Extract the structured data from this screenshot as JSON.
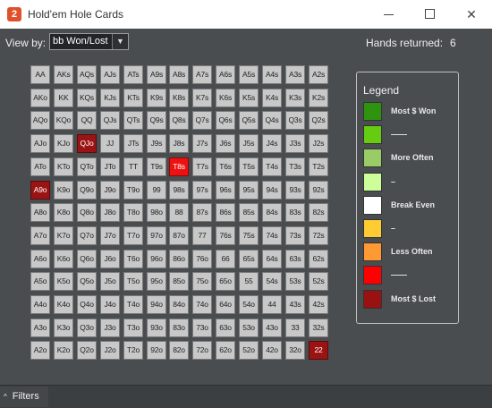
{
  "window": {
    "app_icon": "2",
    "title": "Hold'em Hole Cards",
    "minimize_icon": "minimize-icon",
    "maximize_icon": "maximize-icon",
    "close_icon": "close-icon",
    "close_glyph": "✕"
  },
  "toolbar": {
    "view_by_label": "View by:",
    "view_by_value": "bb Won/Lost",
    "dropdown_arrow": "▼",
    "hands_returned_label": "Hands returned:",
    "hands_returned_value": "6"
  },
  "grid": {
    "rows": [
      [
        "AA",
        "AKs",
        "AQs",
        "AJs",
        "ATs",
        "A9s",
        "A8s",
        "A7s",
        "A6s",
        "A5s",
        "A4s",
        "A3s",
        "A2s"
      ],
      [
        "AKo",
        "KK",
        "KQs",
        "KJs",
        "KTs",
        "K9s",
        "K8s",
        "K7s",
        "K6s",
        "K5s",
        "K4s",
        "K3s",
        "K2s"
      ],
      [
        "AQo",
        "KQo",
        "QQ",
        "QJs",
        "QTs",
        "Q9s",
        "Q8s",
        "Q7s",
        "Q6s",
        "Q5s",
        "Q4s",
        "Q3s",
        "Q2s"
      ],
      [
        "AJo",
        "KJo",
        "QJo",
        "JJ",
        "JTs",
        "J9s",
        "J8s",
        "J7s",
        "J6s",
        "J5s",
        "J4s",
        "J3s",
        "J2s"
      ],
      [
        "ATo",
        "KTo",
        "QTo",
        "JTo",
        "TT",
        "T9s",
        "T8s",
        "T7s",
        "T6s",
        "T5s",
        "T4s",
        "T3s",
        "T2s"
      ],
      [
        "A9o",
        "K9o",
        "Q9o",
        "J9o",
        "T9o",
        "99",
        "98s",
        "97s",
        "96s",
        "95s",
        "94s",
        "93s",
        "92s"
      ],
      [
        "A8o",
        "K8o",
        "Q8o",
        "J8o",
        "T8o",
        "98o",
        "88",
        "87s",
        "86s",
        "85s",
        "84s",
        "83s",
        "82s"
      ],
      [
        "A7o",
        "K7o",
        "Q7o",
        "J7o",
        "T7o",
        "97o",
        "87o",
        "77",
        "76s",
        "75s",
        "74s",
        "73s",
        "72s"
      ],
      [
        "A6o",
        "K6o",
        "Q6o",
        "J6o",
        "T6o",
        "96o",
        "86o",
        "76o",
        "66",
        "65s",
        "64s",
        "63s",
        "62s"
      ],
      [
        "A5o",
        "K5o",
        "Q5o",
        "J5o",
        "T5o",
        "95o",
        "85o",
        "75o",
        "65o",
        "55",
        "54s",
        "53s",
        "52s"
      ],
      [
        "A4o",
        "K4o",
        "Q4o",
        "J4o",
        "T4o",
        "94o",
        "84o",
        "74o",
        "64o",
        "54o",
        "44",
        "43s",
        "42s"
      ],
      [
        "A3o",
        "K3o",
        "Q3o",
        "J3o",
        "T3o",
        "93o",
        "83o",
        "73o",
        "63o",
        "53o",
        "43o",
        "33",
        "32s"
      ],
      [
        "A2o",
        "K2o",
        "Q2o",
        "J2o",
        "T2o",
        "92o",
        "82o",
        "72o",
        "62o",
        "52o",
        "42o",
        "32o",
        "22"
      ]
    ],
    "highlights": {
      "QJo": "#9b1414",
      "A9o": "#9b1414",
      "T8s": "#ee1111",
      "22": "#9b1414"
    },
    "default_cell_color": "#c8c8c8"
  },
  "legend": {
    "title": "Legend",
    "items": [
      {
        "label": "Most $ Won",
        "color": "#2e9410"
      },
      {
        "label": "——",
        "color": "#66cc11"
      },
      {
        "label": "More Often",
        "color": "#99cc66"
      },
      {
        "label": "–",
        "color": "#ccff99"
      },
      {
        "label": "Break Even",
        "color": "#ffffff"
      },
      {
        "label": "–",
        "color": "#ffcc33"
      },
      {
        "label": "Less Often",
        "color": "#ff9933"
      },
      {
        "label": "——",
        "color": "#ff0000"
      },
      {
        "label": "Most $ Lost",
        "color": "#991111"
      }
    ]
  },
  "footer": {
    "filters_caret": "^",
    "filters_label": "Filters"
  }
}
